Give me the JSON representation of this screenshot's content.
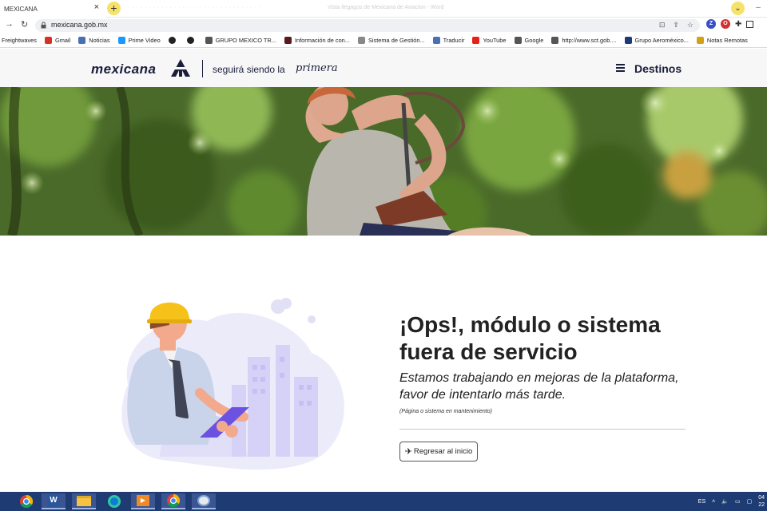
{
  "browser": {
    "tab_title": "MEXICANA",
    "tab_close": "×",
    "new_tab": "+",
    "ghost_tabs": "· · · · · · · · · · · · · · · · · · · · · · · · · · · · · · · ·",
    "window_title": "Vista ilegagos de Mexicana de Aviacion - Word",
    "url": "mexicana.gob.mx",
    "bookmarks": [
      {
        "label": "Freightwaves",
        "icon": "none",
        "color": ""
      },
      {
        "label": "Gmail",
        "icon": "gmail-icon",
        "color": "#d93025"
      },
      {
        "label": "Noticias",
        "icon": "news-icon",
        "color": "#4a6fb5"
      },
      {
        "label": "Prime Video",
        "icon": "prime-video-icon",
        "color": "#1a98ff"
      },
      {
        "label": "",
        "icon": "globe-icon",
        "color": "#222222"
      },
      {
        "label": "",
        "icon": "globe-icon",
        "color": "#222222"
      },
      {
        "label": "GRUPO MEXICO TR...",
        "icon": "google-g-icon",
        "color": "#555555"
      },
      {
        "label": "Información de con...",
        "icon": "info-site-icon",
        "color": "#5a1a1a"
      },
      {
        "label": "Sistema de Gestión...",
        "icon": "system-icon",
        "color": "#888888"
      },
      {
        "label": "Traducir",
        "icon": "translate-icon",
        "color": "#4a6fb5"
      },
      {
        "label": "YouTube",
        "icon": "youtube-icon",
        "color": "#e62117"
      },
      {
        "label": "Google",
        "icon": "google-g-icon",
        "color": "#555555"
      },
      {
        "label": "http://www.sct.gob....",
        "icon": "google-g-icon",
        "color": "#555555"
      },
      {
        "label": "Grupo Aeroméxico...",
        "icon": "aeromexico-icon",
        "color": "#1a3a7a"
      },
      {
        "label": "Notas Remotas",
        "icon": "notes-icon",
        "color": "#d4a017"
      }
    ]
  },
  "site": {
    "logo_word": "mexicana",
    "tagline": "seguirá siendo la",
    "tagline_script": "primera",
    "nav_label": "Destinos"
  },
  "content": {
    "headline": "¡Ops!, módulo o sistema fuera de servicio",
    "subline": "Estamos trabajando en mejoras de la plataforma, favor de intentarlo más tarde.",
    "note": "(Página o sistema en mantenimiento)",
    "back_button": "Regresar al inicio"
  },
  "taskbar": {
    "lang": "ES",
    "time": "04",
    "date": "22"
  },
  "colors": {
    "brand_navy": "#1a1e3a",
    "helmet_yellow": "#f6c21a",
    "tablet_purple": "#6c52e0",
    "taskbar": "#1f3b74"
  }
}
